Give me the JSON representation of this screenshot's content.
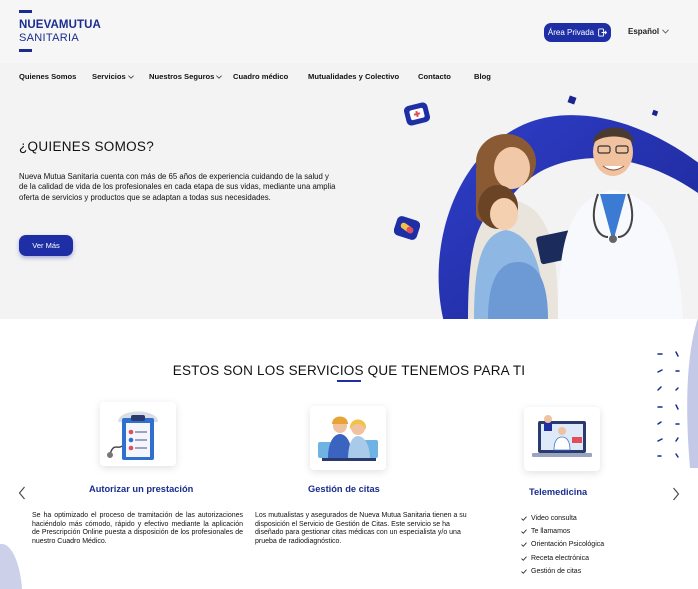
{
  "header": {
    "logo_line1": "NUEVAMUTUA",
    "logo_line2": "SANITARIA",
    "area_privada": "Área Privada",
    "language": "Español"
  },
  "nav": {
    "items": [
      {
        "label": "Quienes Somos"
      },
      {
        "label": "Servicios"
      },
      {
        "label": "Nuestros Seguros"
      },
      {
        "label": "Cuadro médico"
      },
      {
        "label": "Mutualidades y Colectivo"
      },
      {
        "label": "Contacto"
      },
      {
        "label": "Blog"
      }
    ]
  },
  "hero": {
    "title": "¿QUIENES SOMOS?",
    "text": "Nueva Mutua Sanitaria cuenta con más de 65 años de experiencia cuidando de la salud y de la calidad de vida de los profesionales en cada etapa de sus vidas, mediante una amplia  oferta de servicios y productos que se adaptan a todas sus necesidades.",
    "button": "Ver Más"
  },
  "services": {
    "title": "ESTOS SON LOS SERVICIOS QUE TENEMOS PARA TI",
    "cards": [
      {
        "title": "Autorizar un prestación",
        "text": "Se ha optimizado el proceso de tramitación de las autorizaciones haciéndolo más cómodo, rápido y efectivo mediante la aplicación de Prescripción Online puesta a disposición de los profesionales de nuestro Cuadro Médico."
      },
      {
        "title": "Gestión de citas",
        "text": "Los mutualistas y asegurados de Nueva Mutua Sanitaria tienen a su disposición el Servicio de Gestión de Citas. Este servicio se ha diseñado para gestionar citas médicas con un especialista y/o una prueba de radiodiagnóstico."
      },
      {
        "title": "Telemedicina",
        "items": [
          "Video consulta",
          "Te llamamos",
          "Orientación Psicológica",
          "Receta electrónica",
          "Gestión de citas"
        ]
      }
    ]
  },
  "colors": {
    "brand": "#1a2c8f",
    "button": "#1e2fa6",
    "background": "#f3f3f3"
  },
  "icons": [
    "logout-icon",
    "chevron-down-icon",
    "chevron-left-icon",
    "chevron-right-icon",
    "check-icon",
    "first-aid-kit-icon",
    "pill-icon"
  ]
}
